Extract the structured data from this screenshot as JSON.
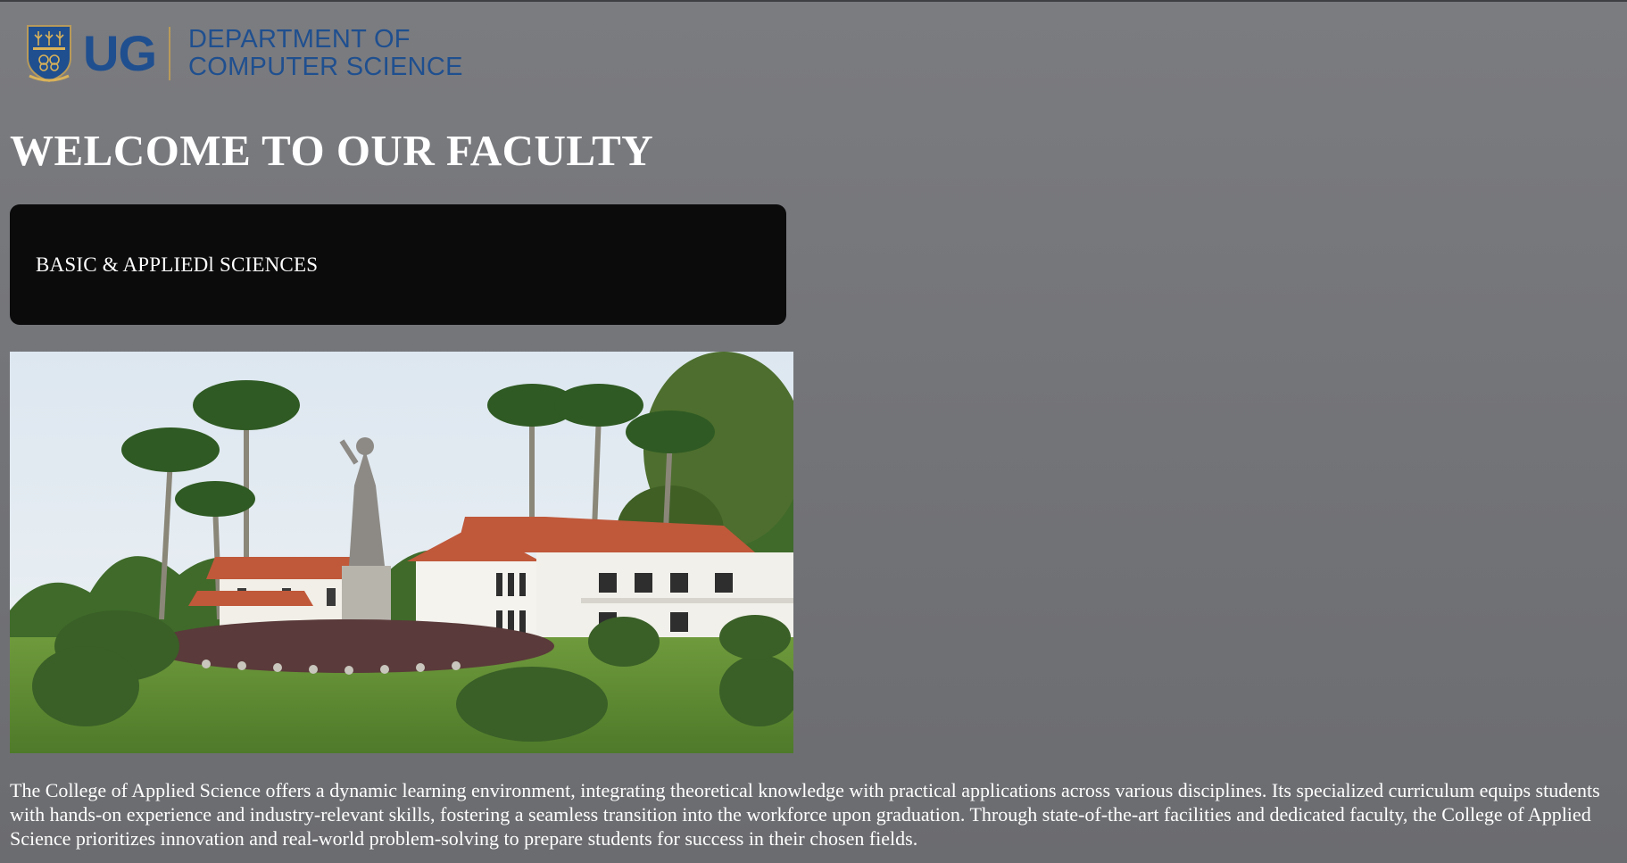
{
  "header": {
    "logo_short": "UG",
    "department_line1": "DEPARTMENT OF",
    "department_line2": "COMPUTER SCIENCE",
    "brand_color": "#1f4f8f",
    "crest_icon": "university-crest-icon"
  },
  "main": {
    "title": "WELCOME TO OUR FACULTY",
    "faculty_card_label": "BASIC & APPLIEDl SCIENCES",
    "photo_icon": "campus-building-photo",
    "description": "The College of Applied Science offers a dynamic learning environment, integrating theoretical knowledge with practical applications across various disciplines. Its specialized curriculum equips students with hands-on experience and industry-relevant skills, fostering a seamless transition into the workforce upon graduation. Through state-of-the-art facilities and dedicated faculty, the College of Applied Science prioritizes innovation and real-world problem-solving to prepare students for success in their chosen fields."
  },
  "colors": {
    "background": "#727377",
    "card_background": "#0b0b0c",
    "text": "#ffffff"
  }
}
